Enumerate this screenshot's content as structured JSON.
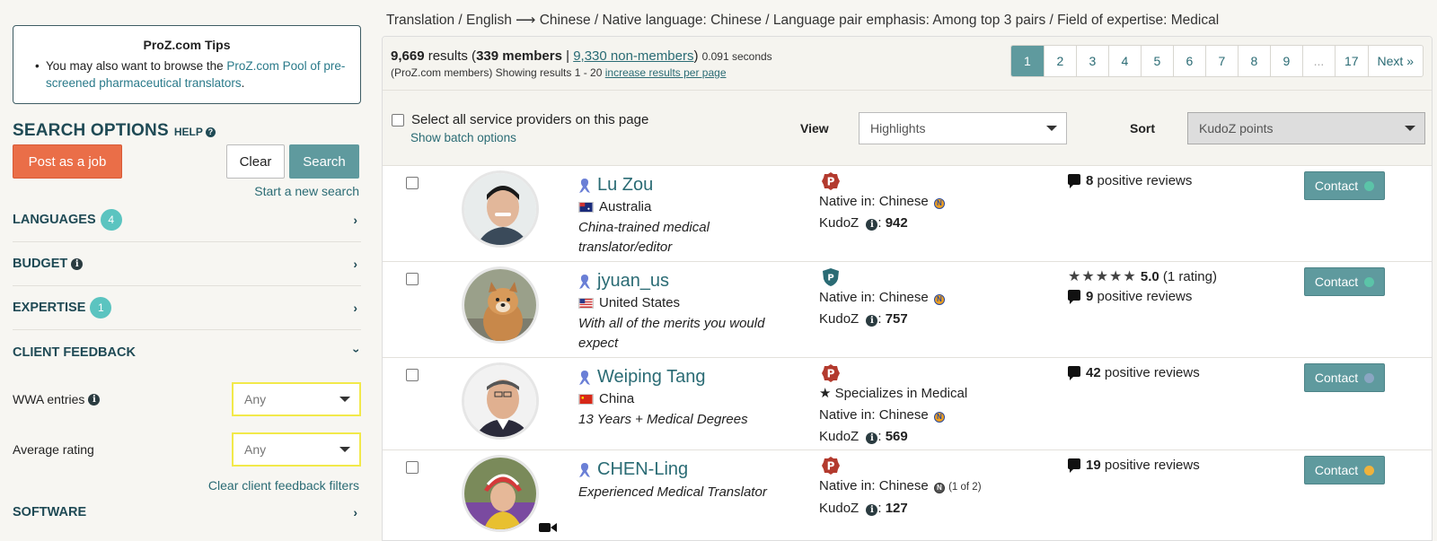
{
  "breadcrumb": "Translation / English ⟶ Chinese / Native language: Chinese / Language pair emphasis: Among top 3 pairs / Field of expertise: Medical",
  "tips": {
    "title": "ProZ.com Tips",
    "text_before": "You may also want to browse the ",
    "link": "ProZ.com Pool of pre-screened pharmaceutical translators",
    "text_after": "."
  },
  "search_options": {
    "title": "SEARCH OPTIONS",
    "help": "HELP",
    "post_job": "Post as a job",
    "clear": "Clear",
    "search": "Search",
    "new_search": "Start a new search"
  },
  "facets": [
    {
      "label": "LANGUAGES",
      "badge": "4"
    },
    {
      "label": "BUDGET",
      "badge": ""
    },
    {
      "label": "EXPERTISE",
      "badge": "1"
    },
    {
      "label": "CLIENT FEEDBACK",
      "badge": ""
    }
  ],
  "client_feedback": {
    "wwa_label": "WWA entries",
    "wwa_value": "Any",
    "rating_label": "Average rating",
    "rating_value": "Any",
    "clear": "Clear client feedback filters"
  },
  "software_label": "SOFTWARE",
  "results": {
    "count": "9,669",
    "results_word": " results (",
    "members": "339 members",
    "sep": " | ",
    "nonmembers": "9,330 non-members",
    "close": ")",
    "seconds": "0.091 seconds",
    "showing": "(ProZ.com members) Showing results 1 - 20",
    "increase": "increase results per page"
  },
  "pager": [
    "1",
    "2",
    "3",
    "4",
    "5",
    "6",
    "7",
    "8",
    "9",
    "...",
    "17",
    "Next »"
  ],
  "toolbar": {
    "select_all": "Select all service providers on this page",
    "batch": "Show batch options",
    "view_label": "View",
    "view_value": "Highlights",
    "sort_label": "Sort",
    "sort_value": "KudoZ points"
  },
  "providers": [
    {
      "name": "Lu Zou",
      "country": "Australia",
      "tagline": "China-trained medical translator/editor",
      "specializes": "",
      "native_label": "Native in:",
      "native": "Chinese",
      "native_extra": "",
      "kudoz_label": "KudoZ",
      "kudoz": "942",
      "rating": "",
      "rating_count": "",
      "reviews": "8",
      "reviews_text": "positive reviews",
      "contact": "Contact",
      "status_color": "#5bc4a8"
    },
    {
      "name": "jyuan_us",
      "country": "United States",
      "tagline": "With all of the merits you would expect",
      "specializes": "",
      "native_label": "Native in:",
      "native": "Chinese",
      "native_extra": "",
      "kudoz_label": "KudoZ",
      "kudoz": "757",
      "rating": "5.0",
      "rating_count": "(1 rating)",
      "reviews": "9",
      "reviews_text": "positive reviews",
      "contact": "Contact",
      "status_color": "#5bc4a8"
    },
    {
      "name": "Weiping Tang",
      "country": "China",
      "tagline": "13 Years + Medical Degrees",
      "specializes": "Specializes in Medical",
      "native_label": "Native in:",
      "native": "Chinese",
      "native_extra": "",
      "kudoz_label": "KudoZ",
      "kudoz": "569",
      "rating": "",
      "rating_count": "",
      "reviews": "42",
      "reviews_text": "positive reviews",
      "contact": "Contact",
      "status_color": "#8aa6c2"
    },
    {
      "name": "CHEN-Ling",
      "country": "",
      "tagline": "Experienced Medical Translator",
      "specializes": "",
      "native_label": "Native in:",
      "native": "Chinese",
      "native_extra": "(1 of 2)",
      "kudoz_label": "KudoZ",
      "kudoz": "127",
      "rating": "",
      "rating_count": "",
      "reviews": "19",
      "reviews_text": "positive reviews",
      "contact": "Contact",
      "status_color": "#f0b23c"
    }
  ]
}
